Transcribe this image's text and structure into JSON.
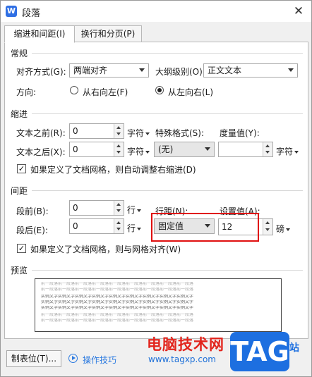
{
  "window": {
    "title": "段落",
    "app_icon": "W"
  },
  "tabs": [
    {
      "label": "缩进和间距(I)"
    },
    {
      "label": "换行和分页(P)"
    }
  ],
  "general": {
    "section": "常规",
    "alignment_label": "对齐方式(G):",
    "alignment_value": "两端对齐",
    "outline_label": "大纲级别(O):",
    "outline_value": "正文文本",
    "direction_label": "方向:",
    "rtl_label": "从右向左(F)",
    "ltr_label": "从左向右(L)"
  },
  "indent": {
    "section": "缩进",
    "before_label": "文本之前(R):",
    "before_value": "0",
    "before_unit": "字符",
    "special_label": "特殊格式(S):",
    "special_value": "(无)",
    "measure_label": "度量值(Y):",
    "measure_value": "",
    "measure_unit": "字符",
    "after_label": "文本之后(X):",
    "after_value": "0",
    "after_unit": "字符",
    "grid_check_label": "如果定义了文档网格，则自动调整右缩进(D)"
  },
  "spacing": {
    "section": "间距",
    "before_label": "段前(B):",
    "before_value": "0",
    "before_unit": "行",
    "after_label": "段后(E):",
    "after_value": "0",
    "after_unit": "行",
    "line_label": "行距(N):",
    "line_value": "固定值",
    "set_label": "设置值(A):",
    "set_value": "12",
    "set_unit": "磅",
    "grid_check_label": "如果定义了文档网格，则与网格对齐(W)"
  },
  "preview": {
    "section": "预览",
    "prev_text": "前一段落前一段落前一段落前一段落前一段落前一段落前一段落前一段落前一段落",
    "sample_text": "实例文字实例文字实例文字实例文字实例文字实例文字实例文字实例文字实例文字"
  },
  "footer": {
    "tabs_button": "制表位(T)...",
    "tips_link": "操作技巧"
  },
  "watermark": {
    "site_name": "电脑技术网",
    "url": "www.tagxp.com",
    "badge": "TAG",
    "badge_side": "站"
  }
}
